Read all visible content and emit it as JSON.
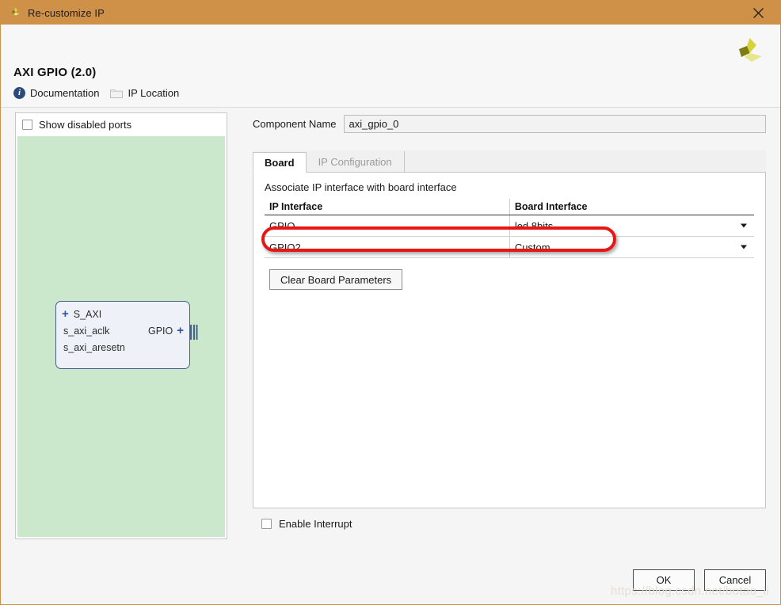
{
  "window": {
    "title": "Re-customize IP",
    "title_icon": "xilinx-logo-icon",
    "close_icon": "close-icon"
  },
  "header": {
    "ip_title": "AXI GPIO (2.0)",
    "logo_icon": "xilinx-pinwheel-logo",
    "links": [
      {
        "label": "Documentation",
        "icon": "info-icon"
      },
      {
        "label": "IP Location",
        "icon": "folder-icon"
      }
    ]
  },
  "diagram": {
    "show_disabled_ports_label": "Show disabled ports",
    "show_disabled_ports_checked": false,
    "canvas_color": "#cce8cc",
    "block": {
      "fill_color": "#eef2f8",
      "border_color": "#44628c",
      "ports_left": [
        {
          "name": "S_AXI",
          "expandable": true,
          "pin_icon": "bus-interface-pin-icon"
        },
        {
          "name": "s_axi_aclk",
          "expandable": false,
          "pin_icon": "clock-pin-icon"
        },
        {
          "name": "s_axi_aresetn",
          "expandable": false,
          "pin_icon": "active-low-reset-pin-icon"
        }
      ],
      "ports_right": [
        {
          "name": "GPIO",
          "expandable": true,
          "pin_icon": "bus-output-pin-icon"
        }
      ]
    }
  },
  "form": {
    "component_name_label": "Component Name",
    "component_name_value": "axi_gpio_0"
  },
  "tabs": [
    {
      "label": "Board",
      "active": true
    },
    {
      "label": "IP Configuration",
      "active": false
    }
  ],
  "board_tab": {
    "associate_label": "Associate IP interface with board interface",
    "table": {
      "columns": [
        "IP Interface",
        "Board Interface"
      ],
      "rows": [
        {
          "ip_interface": "GPIO",
          "board_interface": "led 8bits",
          "highlighted": true
        },
        {
          "ip_interface": "GPIO2",
          "board_interface": "Custom",
          "highlighted": false
        }
      ]
    },
    "clear_button_label": "Clear Board Parameters",
    "annotation_color": "#e81515"
  },
  "options": {
    "enable_interrupt_label": "Enable Interrupt",
    "enable_interrupt_checked": false
  },
  "footer": {
    "ok_label": "OK",
    "cancel_label": "Cancel"
  },
  "watermark": {
    "text": "https://blog.csdn.net/botao_li"
  }
}
